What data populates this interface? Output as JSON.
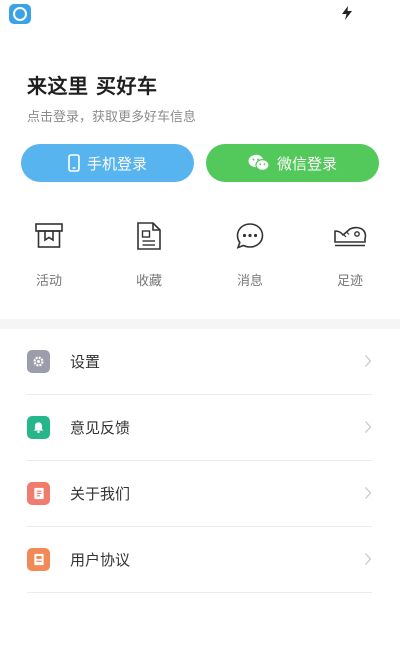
{
  "status_bar": {
    "app_icon": "app-logo-icon",
    "right_icon": "flash-icon"
  },
  "header": {
    "title": "来这里 买好车",
    "subtitle": "点击登录，获取更多好车信息"
  },
  "login": {
    "phone_label": "手机登录",
    "phone_icon": "phone-icon",
    "phone_color": "#58b4ef",
    "wechat_label": "微信登录",
    "wechat_icon": "wechat-icon",
    "wechat_color": "#52c95a"
  },
  "quick_links": [
    {
      "label": "活动",
      "icon": "gift-box-icon"
    },
    {
      "label": "收藏",
      "icon": "document-icon"
    },
    {
      "label": "消息",
      "icon": "chat-bubble-icon"
    },
    {
      "label": "足迹",
      "icon": "shoe-icon"
    }
  ],
  "menu": [
    {
      "label": "设置",
      "icon": "gear-icon",
      "color": "#9b9eaa"
    },
    {
      "label": "意见反馈",
      "icon": "bell-icon",
      "color": "#26b68c"
    },
    {
      "label": "关于我们",
      "icon": "info-doc-icon",
      "color": "#f07c6e"
    },
    {
      "label": "用户协议",
      "icon": "agreement-icon",
      "color": "#f28a57"
    }
  ]
}
